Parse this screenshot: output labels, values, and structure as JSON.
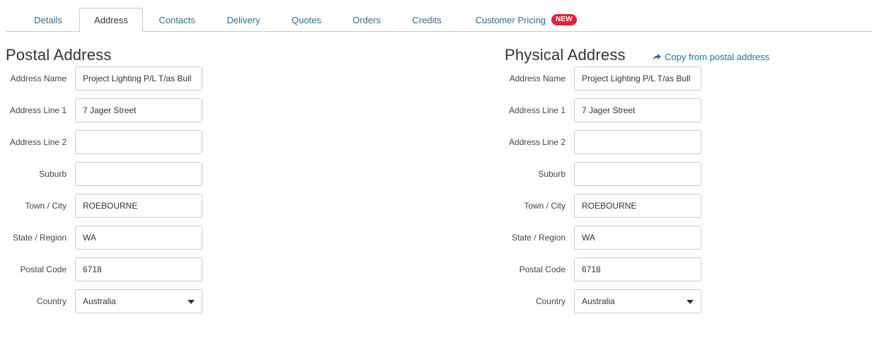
{
  "tabs": [
    {
      "label": "Details"
    },
    {
      "label": "Address"
    },
    {
      "label": "Contacts"
    },
    {
      "label": "Delivery"
    },
    {
      "label": "Quotes"
    },
    {
      "label": "Orders"
    },
    {
      "label": "Credits"
    },
    {
      "label": "Customer Pricing",
      "badge": "NEW"
    }
  ],
  "active_tab": "Address",
  "colors": {
    "link": "#2a6f97",
    "badge": "#e0213a"
  },
  "postal": {
    "title": "Postal Address",
    "fields": {
      "address_name": {
        "label": "Address Name",
        "value": "Project Lighting P/L T/as Bull"
      },
      "address_line_1": {
        "label": "Address Line 1",
        "value": "7 Jager Street"
      },
      "address_line_2": {
        "label": "Address Line 2",
        "value": ""
      },
      "suburb": {
        "label": "Suburb",
        "value": ""
      },
      "town_city": {
        "label": "Town / City",
        "value": "ROEBOURNE"
      },
      "state_region": {
        "label": "State / Region",
        "value": "WA"
      },
      "postal_code": {
        "label": "Postal Code",
        "value": "6718"
      },
      "country": {
        "label": "Country",
        "value": "Australia"
      }
    }
  },
  "physical": {
    "title": "Physical Address",
    "copy_link": "Copy from postal address",
    "fields": {
      "address_name": {
        "label": "Address Name",
        "value": "Project Lighting P/L T/as Bull"
      },
      "address_line_1": {
        "label": "Address Line 1",
        "value": "7 Jager Street"
      },
      "address_line_2": {
        "label": "Address Line 2",
        "value": ""
      },
      "suburb": {
        "label": "Suburb",
        "value": ""
      },
      "town_city": {
        "label": "Town / City",
        "value": "ROEBOURNE"
      },
      "state_region": {
        "label": "State / Region",
        "value": "WA"
      },
      "postal_code": {
        "label": "Postal Code",
        "value": "6718"
      },
      "country": {
        "label": "Country",
        "value": "Australia"
      }
    }
  }
}
